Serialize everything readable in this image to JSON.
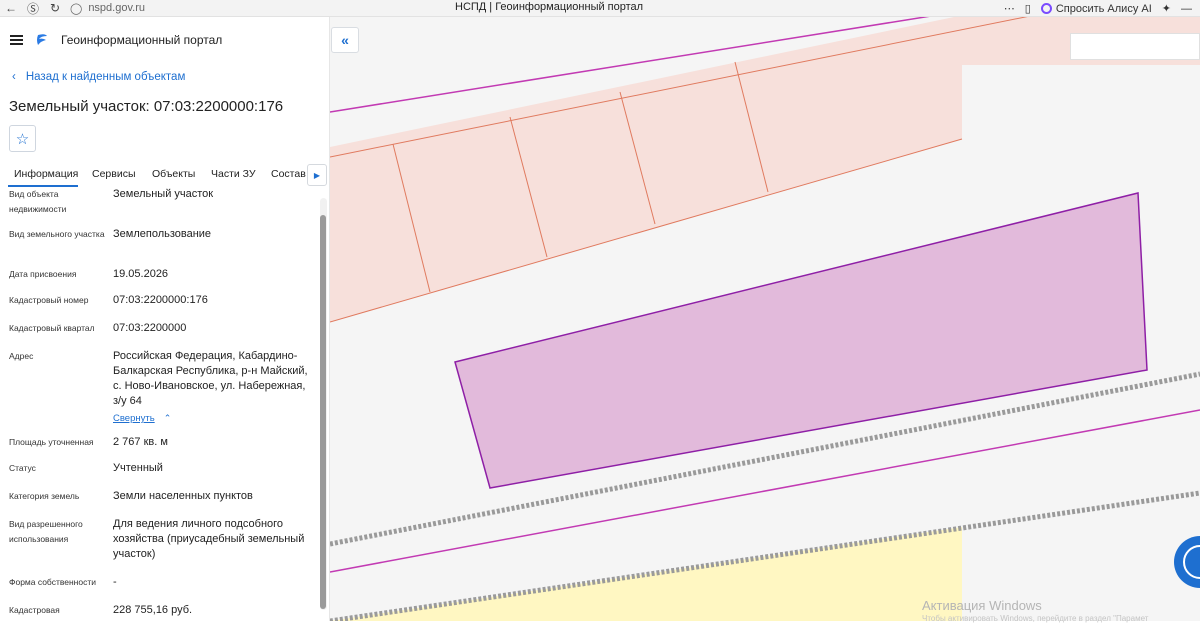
{
  "browser": {
    "url": "nspd.gov.ru",
    "tab_title": "НСПД | Геоинформационный портал",
    "alice_label": "Спросить Алису AI"
  },
  "app": {
    "portal_title": "Геоинформационный портал",
    "back_link": "Назад к найденным объектам",
    "object_title": "Земельный участок: 07:03:2200000:176"
  },
  "tabs": [
    "Информация",
    "Сервисы",
    "Объекты",
    "Части ЗУ",
    "Состав"
  ],
  "attributes": [
    {
      "label": "Вид объекта недвижимости",
      "value": "Земельный участок"
    },
    {
      "label": "Вид земельного участка",
      "value": "Землепользование"
    },
    {
      "label": "Дата присвоения",
      "value": "19.05.2026"
    },
    {
      "label": "Кадастровый номер",
      "value": "07:03:2200000:176"
    },
    {
      "label": "Кадастровый квартал",
      "value": "07:03:2200000"
    },
    {
      "label": "Адрес",
      "value": "Российская Федерация, Кабардино-Балкарская Республика, р-н Майский, с. Ново-Ивановское, ул. Набережная, з/у 64"
    },
    {
      "label": "Площадь уточненная",
      "value": "2 767 кв. м"
    },
    {
      "label": "Статус",
      "value": "Учтенный"
    },
    {
      "label": "Категория земель",
      "value": "Земли населенных пунктов"
    },
    {
      "label": "Вид разрешенного использования",
      "value": "Для ведения личного подсобного хозяйства (приусадебный земельный участок)"
    },
    {
      "label": "Форма собственности",
      "value": "-"
    },
    {
      "label": "Кадастровая",
      "value": "228 755,16 руб."
    }
  ],
  "address_collapse": "Свернуть",
  "watermark": {
    "line1": "Активация Windows",
    "line2": "Чтобы активировать Windows, перейдите в раздел \"Парамет"
  },
  "colors": {
    "accent": "#1e6fd0",
    "selected_parcel_fill": "#e0b4d8",
    "selected_parcel_stroke": "#8e1fa6",
    "neighbor_fill": "#f7e0db",
    "neighbor_stroke": "#e07a5f",
    "road_line": "#c23ab3"
  }
}
